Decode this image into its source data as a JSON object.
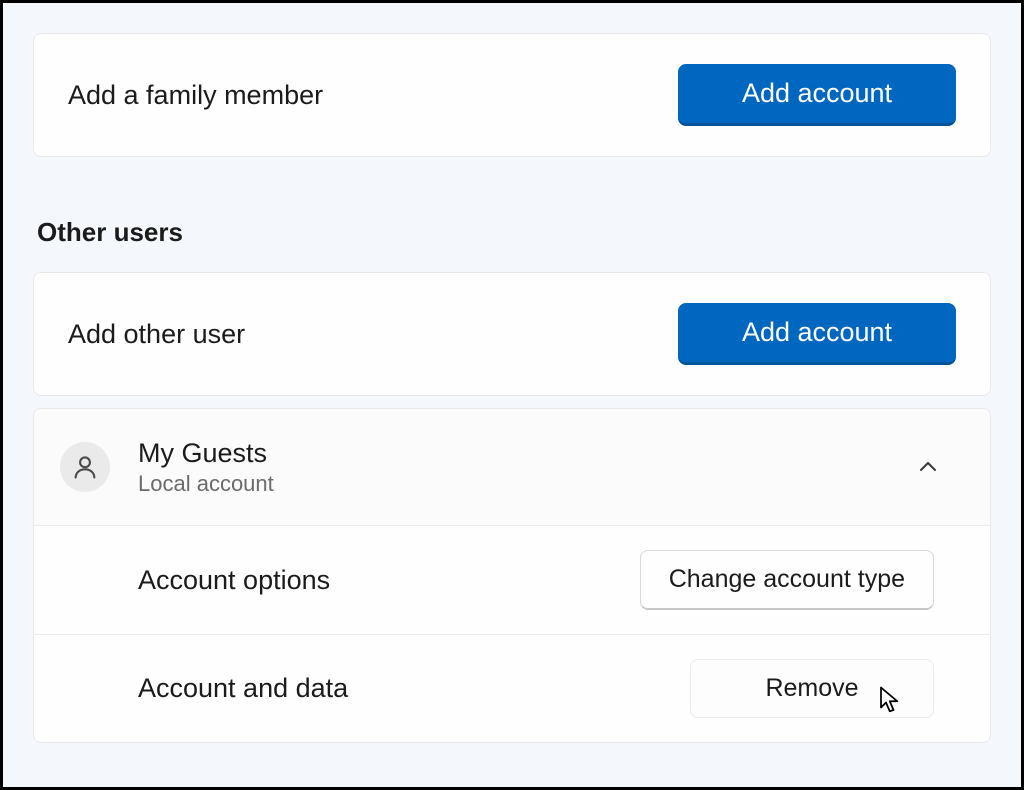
{
  "family": {
    "add_label": "Add a family member",
    "add_button": "Add account"
  },
  "other_users": {
    "section_title": "Other users",
    "add_label": "Add other user",
    "add_button": "Add account"
  },
  "user": {
    "name": "My Guests",
    "type": "Local account",
    "options_label": "Account options",
    "change_type_button": "Change account type",
    "data_label": "Account and data",
    "remove_button": "Remove"
  }
}
